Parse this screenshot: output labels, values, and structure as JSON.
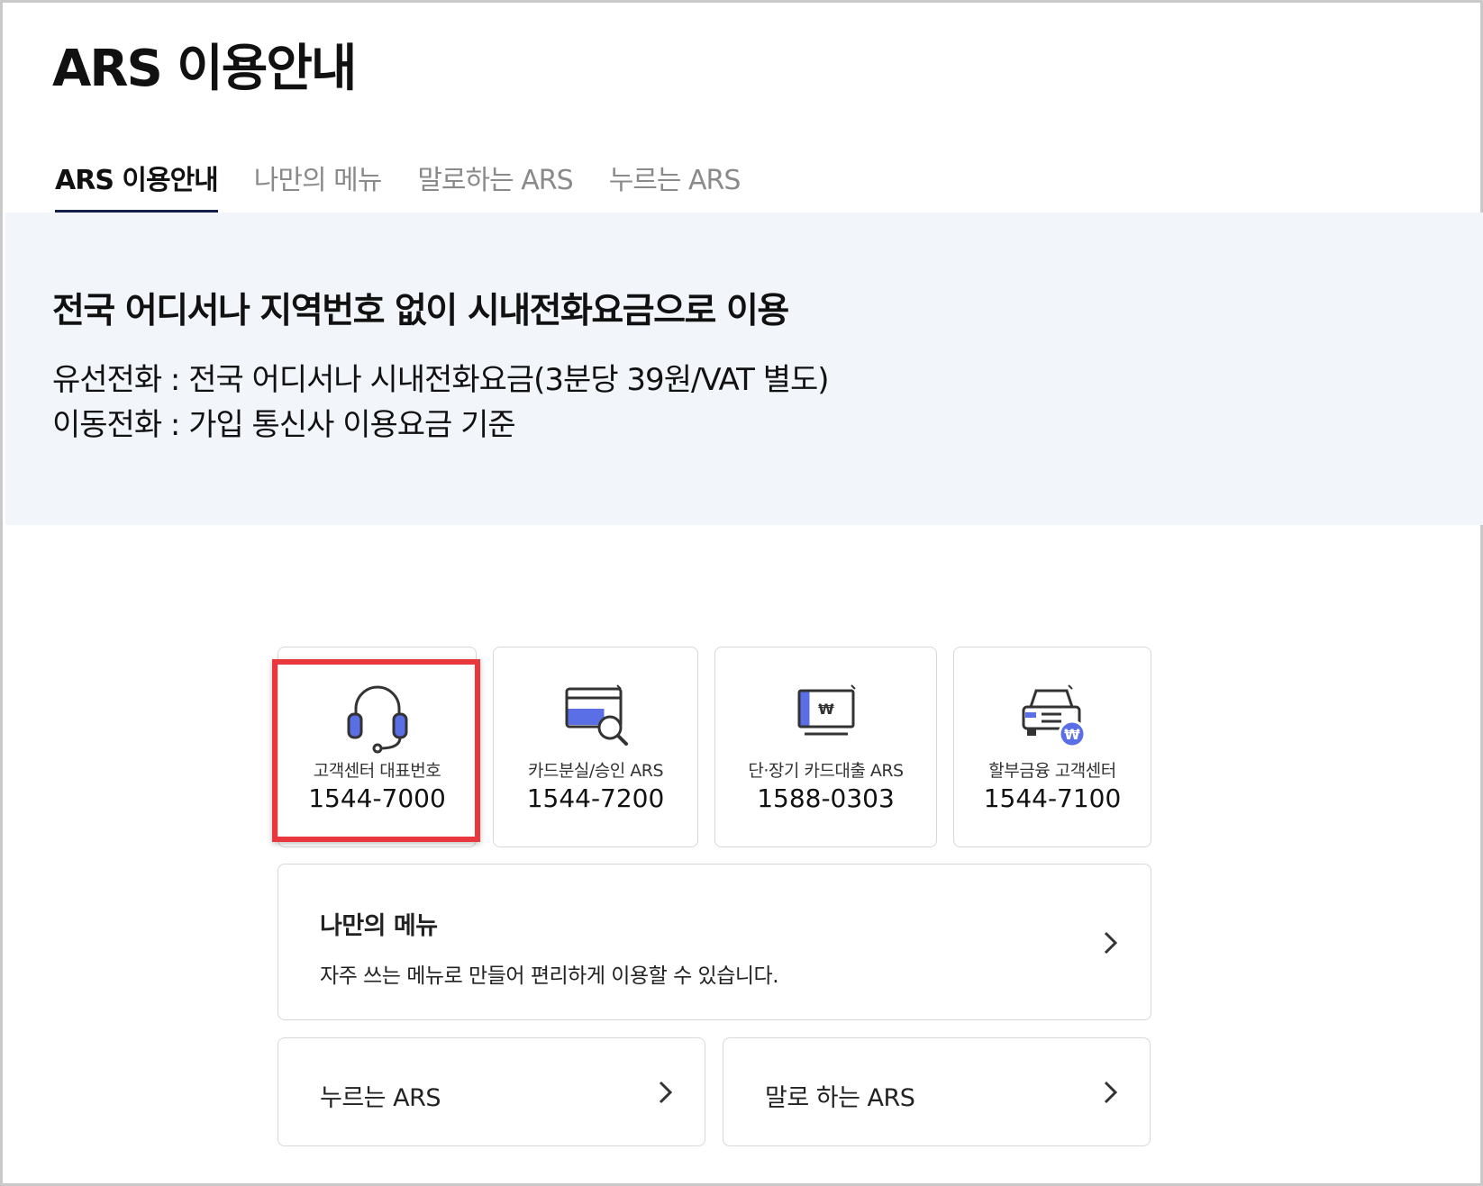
{
  "page": {
    "title": "ARS 이용안내"
  },
  "tabs": [
    {
      "label": "ARS 이용안내",
      "active": true
    },
    {
      "label": "나만의 메뉴",
      "active": false
    },
    {
      "label": "말로하는 ARS",
      "active": false
    },
    {
      "label": "누르는 ARS",
      "active": false
    }
  ],
  "banner": {
    "title": "전국 어디서나 지역번호 없이 시내전화요금으로 이용",
    "line1": "유선전화 : 전국 어디서나 시내전화요금(3분당 39원/VAT 별도)",
    "line2": "이동전화 : 가입 통신사 이용요금 기준"
  },
  "cards": [
    {
      "label": "고객센터 대표번호",
      "number": "1544-7000",
      "icon": "headset-icon",
      "highlighted": true
    },
    {
      "label": "카드분실/승인 ARS",
      "number": "1544-7200",
      "icon": "card-search-icon",
      "highlighted": false
    },
    {
      "label": "단·장기 카드대출 ARS",
      "number": "1588-0303",
      "icon": "loan-monitor-icon",
      "highlighted": false
    },
    {
      "label": "할부금융 고객센터",
      "number": "1544-7100",
      "icon": "car-finance-icon",
      "highlighted": false
    }
  ],
  "my_menu": {
    "title": "나만의 메뉴",
    "description": "자주 쓰는 메뉴로 만들어 편리하게 이용할 수 있습니다."
  },
  "links": [
    {
      "title": "누르는 ARS"
    },
    {
      "title": "말로 하는 ARS"
    }
  ],
  "colors": {
    "accent": "#5a6fe6",
    "tab_underline": "#15204a",
    "banner_bg": "#f2f5fa",
    "highlight": "#e8383d",
    "icon_stroke": "#333333"
  }
}
